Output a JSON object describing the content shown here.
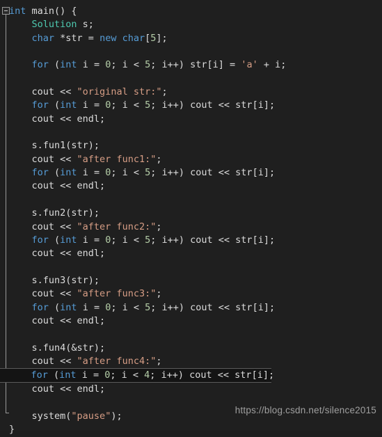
{
  "editor": {
    "language": "cpp",
    "theme": "dark",
    "background_color": "#1f1f1f",
    "colors": {
      "keyword": "#569cd6",
      "type": "#4ec9b0",
      "number": "#b5cea8",
      "string": "#d69d85",
      "plain": "#dcdcdc",
      "current_line_background": "#141414",
      "current_line_border": "#5a5a5a",
      "fold_margin": "#9a9a9a"
    },
    "gutter": {
      "fold_toggle_label": "−",
      "fold_toggle_state": "expanded"
    },
    "current_line_number": 27
  },
  "code_lines": [
    {
      "n": 1,
      "indent": 0,
      "current": false,
      "tokens": [
        {
          "t": "int",
          "c": "kw"
        },
        {
          "t": " main() {",
          "c": "pln"
        }
      ]
    },
    {
      "n": 2,
      "indent": 1,
      "current": false,
      "tokens": [
        {
          "t": "Solution",
          "c": "typ"
        },
        {
          "t": " s;",
          "c": "pln"
        }
      ]
    },
    {
      "n": 3,
      "indent": 1,
      "current": false,
      "tokens": [
        {
          "t": "char",
          "c": "kw"
        },
        {
          "t": " *str = ",
          "c": "pln"
        },
        {
          "t": "new",
          "c": "kw"
        },
        {
          "t": " ",
          "c": "pln"
        },
        {
          "t": "char",
          "c": "kw"
        },
        {
          "t": "[",
          "c": "pln"
        },
        {
          "t": "5",
          "c": "num"
        },
        {
          "t": "];",
          "c": "pln"
        }
      ]
    },
    {
      "n": 4,
      "indent": 0,
      "current": false,
      "tokens": []
    },
    {
      "n": 5,
      "indent": 1,
      "current": false,
      "tokens": [
        {
          "t": "for",
          "c": "kw"
        },
        {
          "t": " (",
          "c": "pln"
        },
        {
          "t": "int",
          "c": "kw"
        },
        {
          "t": " i = ",
          "c": "pln"
        },
        {
          "t": "0",
          "c": "num"
        },
        {
          "t": "; i < ",
          "c": "pln"
        },
        {
          "t": "5",
          "c": "num"
        },
        {
          "t": "; i++) str[i] = ",
          "c": "pln"
        },
        {
          "t": "'a'",
          "c": "str"
        },
        {
          "t": " + i;",
          "c": "pln"
        }
      ]
    },
    {
      "n": 6,
      "indent": 0,
      "current": false,
      "tokens": []
    },
    {
      "n": 7,
      "indent": 1,
      "current": false,
      "tokens": [
        {
          "t": "cout << ",
          "c": "pln"
        },
        {
          "t": "\"original str:\"",
          "c": "str"
        },
        {
          "t": ";",
          "c": "pln"
        }
      ]
    },
    {
      "n": 8,
      "indent": 1,
      "current": false,
      "tokens": [
        {
          "t": "for",
          "c": "kw"
        },
        {
          "t": " (",
          "c": "pln"
        },
        {
          "t": "int",
          "c": "kw"
        },
        {
          "t": " i = ",
          "c": "pln"
        },
        {
          "t": "0",
          "c": "num"
        },
        {
          "t": "; i < ",
          "c": "pln"
        },
        {
          "t": "5",
          "c": "num"
        },
        {
          "t": "; i++) cout << str[i];",
          "c": "pln"
        }
      ]
    },
    {
      "n": 9,
      "indent": 1,
      "current": false,
      "tokens": [
        {
          "t": "cout << endl;",
          "c": "pln"
        }
      ]
    },
    {
      "n": 10,
      "indent": 0,
      "current": false,
      "tokens": []
    },
    {
      "n": 11,
      "indent": 1,
      "current": false,
      "tokens": [
        {
          "t": "s.fun1(str);",
          "c": "pln"
        }
      ]
    },
    {
      "n": 12,
      "indent": 1,
      "current": false,
      "tokens": [
        {
          "t": "cout << ",
          "c": "pln"
        },
        {
          "t": "\"after func1:\"",
          "c": "str"
        },
        {
          "t": ";",
          "c": "pln"
        }
      ]
    },
    {
      "n": 13,
      "indent": 1,
      "current": false,
      "tokens": [
        {
          "t": "for",
          "c": "kw"
        },
        {
          "t": " (",
          "c": "pln"
        },
        {
          "t": "int",
          "c": "kw"
        },
        {
          "t": " i = ",
          "c": "pln"
        },
        {
          "t": "0",
          "c": "num"
        },
        {
          "t": "; i < ",
          "c": "pln"
        },
        {
          "t": "5",
          "c": "num"
        },
        {
          "t": "; i++) cout << str[i];",
          "c": "pln"
        }
      ]
    },
    {
      "n": 14,
      "indent": 1,
      "current": false,
      "tokens": [
        {
          "t": "cout << endl;",
          "c": "pln"
        }
      ]
    },
    {
      "n": 15,
      "indent": 0,
      "current": false,
      "tokens": []
    },
    {
      "n": 16,
      "indent": 1,
      "current": false,
      "tokens": [
        {
          "t": "s.fun2(str);",
          "c": "pln"
        }
      ]
    },
    {
      "n": 17,
      "indent": 1,
      "current": false,
      "tokens": [
        {
          "t": "cout << ",
          "c": "pln"
        },
        {
          "t": "\"after func2:\"",
          "c": "str"
        },
        {
          "t": ";",
          "c": "pln"
        }
      ]
    },
    {
      "n": 18,
      "indent": 1,
      "current": false,
      "tokens": [
        {
          "t": "for",
          "c": "kw"
        },
        {
          "t": " (",
          "c": "pln"
        },
        {
          "t": "int",
          "c": "kw"
        },
        {
          "t": " i = ",
          "c": "pln"
        },
        {
          "t": "0",
          "c": "num"
        },
        {
          "t": "; i < ",
          "c": "pln"
        },
        {
          "t": "5",
          "c": "num"
        },
        {
          "t": "; i++) cout << str[i];",
          "c": "pln"
        }
      ]
    },
    {
      "n": 19,
      "indent": 1,
      "current": false,
      "tokens": [
        {
          "t": "cout << endl;",
          "c": "pln"
        }
      ]
    },
    {
      "n": 20,
      "indent": 0,
      "current": false,
      "tokens": []
    },
    {
      "n": 21,
      "indent": 1,
      "current": false,
      "tokens": [
        {
          "t": "s.fun3(str);",
          "c": "pln"
        }
      ]
    },
    {
      "n": 22,
      "indent": 1,
      "current": false,
      "tokens": [
        {
          "t": "cout << ",
          "c": "pln"
        },
        {
          "t": "\"after func3:\"",
          "c": "str"
        },
        {
          "t": ";",
          "c": "pln"
        }
      ]
    },
    {
      "n": 23,
      "indent": 1,
      "current": false,
      "tokens": [
        {
          "t": "for",
          "c": "kw"
        },
        {
          "t": " (",
          "c": "pln"
        },
        {
          "t": "int",
          "c": "kw"
        },
        {
          "t": " i = ",
          "c": "pln"
        },
        {
          "t": "0",
          "c": "num"
        },
        {
          "t": "; i < ",
          "c": "pln"
        },
        {
          "t": "5",
          "c": "num"
        },
        {
          "t": "; i++) cout << str[i];",
          "c": "pln"
        }
      ]
    },
    {
      "n": 24,
      "indent": 1,
      "current": false,
      "tokens": [
        {
          "t": "cout << endl;",
          "c": "pln"
        }
      ]
    },
    {
      "n": 25,
      "indent": 0,
      "current": false,
      "tokens": []
    },
    {
      "n": 26,
      "indent": 1,
      "current": false,
      "tokens": [
        {
          "t": "s.fun4(&str);",
          "c": "pln"
        }
      ]
    },
    {
      "n": 27,
      "indent": 1,
      "current": false,
      "tokens": [
        {
          "t": "cout << ",
          "c": "pln"
        },
        {
          "t": "\"after func4:\"",
          "c": "str"
        },
        {
          "t": ";",
          "c": "pln"
        }
      ]
    },
    {
      "n": 28,
      "indent": 1,
      "current": true,
      "tokens": [
        {
          "t": "for",
          "c": "kw"
        },
        {
          "t": " (",
          "c": "pln"
        },
        {
          "t": "int",
          "c": "kw"
        },
        {
          "t": " i = ",
          "c": "pln"
        },
        {
          "t": "0",
          "c": "num"
        },
        {
          "t": "; i < ",
          "c": "pln"
        },
        {
          "t": "4",
          "c": "num"
        },
        {
          "t": "; i++) cout << str[i];",
          "c": "pln"
        }
      ]
    },
    {
      "n": 29,
      "indent": 1,
      "current": false,
      "tokens": [
        {
          "t": "cout << endl;",
          "c": "pln"
        }
      ]
    },
    {
      "n": 30,
      "indent": 0,
      "current": false,
      "tokens": []
    },
    {
      "n": 31,
      "indent": 1,
      "current": false,
      "tokens": [
        {
          "t": "system(",
          "c": "pln"
        },
        {
          "t": "\"pause\"",
          "c": "str"
        },
        {
          "t": ");",
          "c": "pln"
        }
      ]
    },
    {
      "n": 32,
      "indent": 0,
      "current": false,
      "tokens": [
        {
          "t": "}",
          "c": "pln"
        }
      ]
    }
  ],
  "watermark": {
    "text": "https://blog.csdn.net/silence2015"
  }
}
